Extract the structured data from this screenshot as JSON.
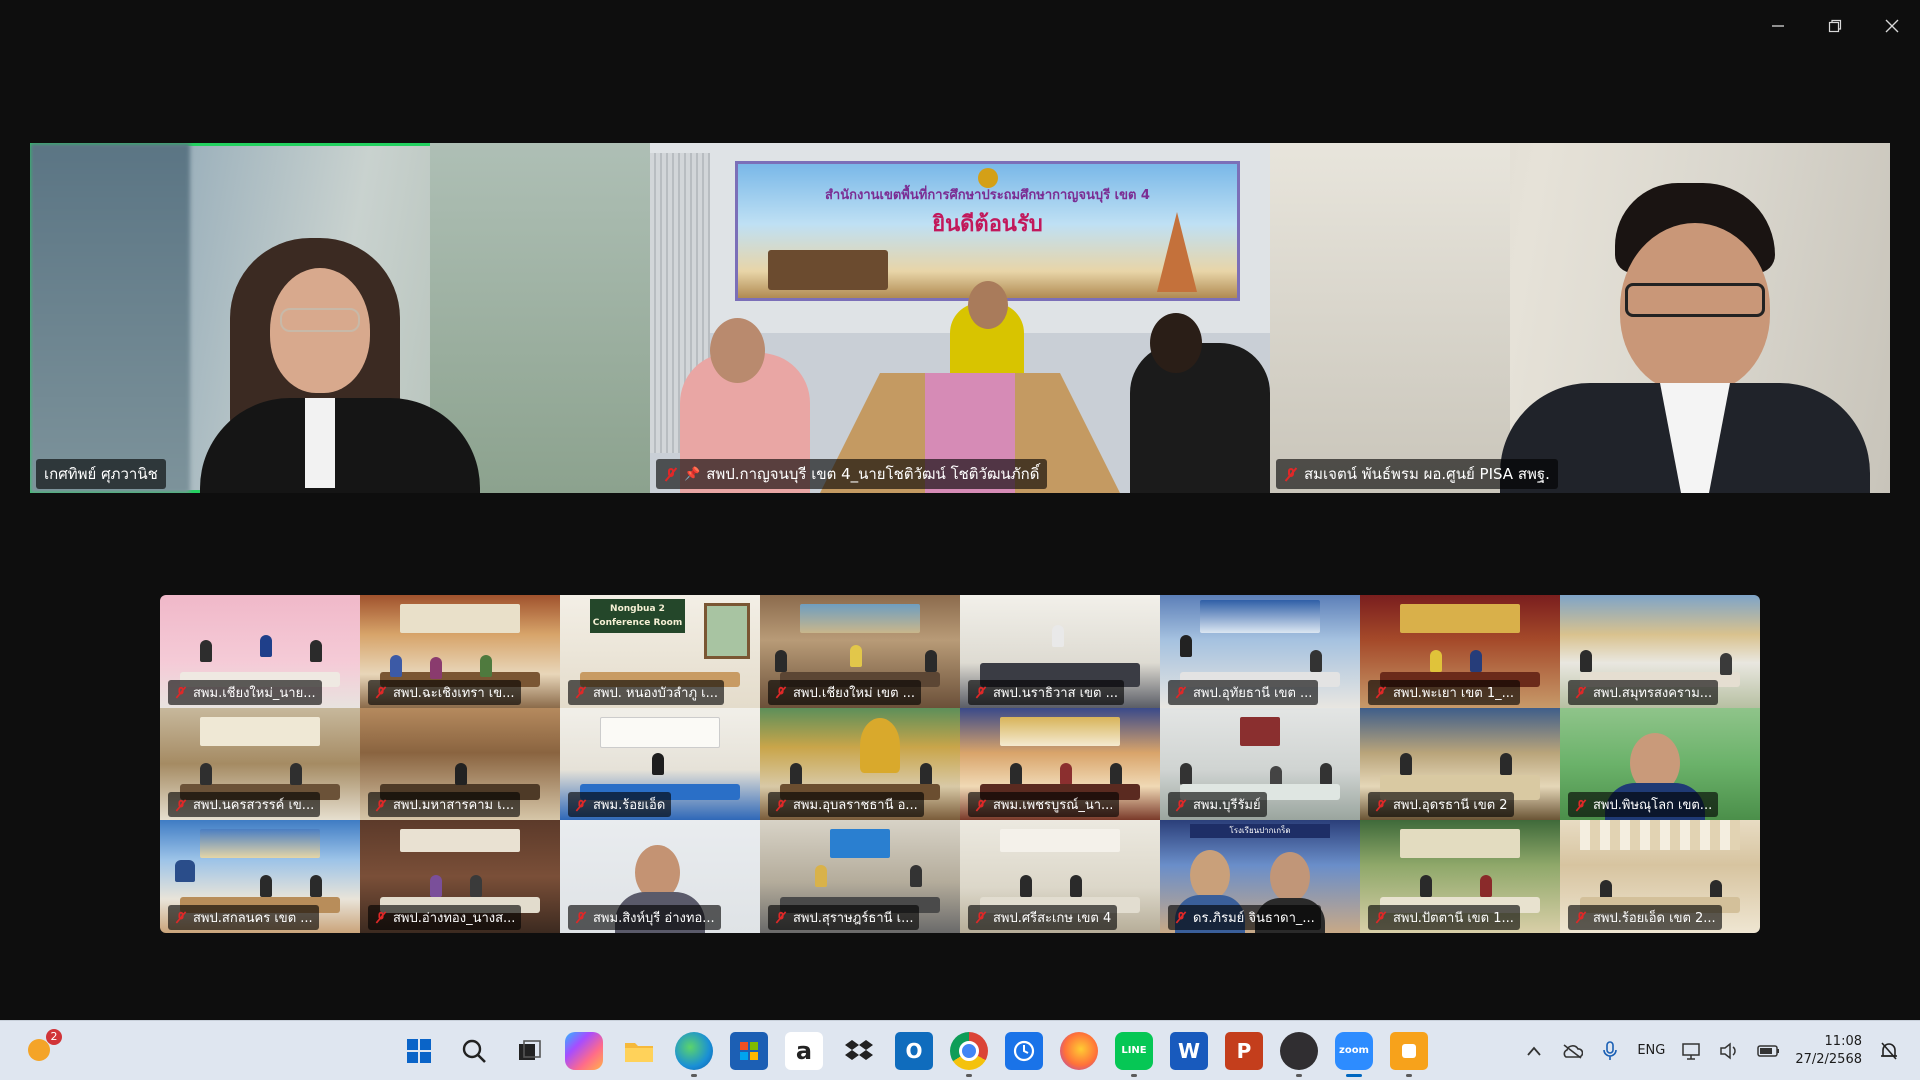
{
  "window": {
    "minimize_icon": "minimize-icon",
    "restore_icon": "restore-icon",
    "close_icon": "close-icon"
  },
  "speakers": [
    {
      "name": "เกศทิพย์ ศุภวานิช",
      "muted": false,
      "pinned": false,
      "active": true
    },
    {
      "name": "สพป.กาญจนบุรี เขต 4_นายโชติวัฒน์ โชติวัฒนภักดิ์",
      "muted": true,
      "pinned": true,
      "active": false
    },
    {
      "name": "สมเจตน์ พันธ์พรม ผอ.ศูนย์ PISA สพฐ.",
      "muted": true,
      "pinned": false,
      "active": false
    }
  ],
  "speaker_scene": {
    "banner_line1": "สำนักงานเขตพื้นที่การศึกษาประถมศึกษากาญจนบุรี เขต 4",
    "banner_line2": "ยินดีต้อนรับ"
  },
  "gallery": [
    {
      "label": "สพม.เชียงใหม่_นาย...",
      "muted": true
    },
    {
      "label": "สพป.ฉะเชิงเทรา เข...",
      "muted": true
    },
    {
      "label": "สพป. หนองบัวลำภู เ...",
      "muted": true,
      "scene_text": "Nongbua 2 Conference Room"
    },
    {
      "label": "สพป.เชียงใหม่ เขต ...",
      "muted": true
    },
    {
      "label": "สพป.นราธิวาส เขต ...",
      "muted": true
    },
    {
      "label": "สพป.อุทัยธานี เขต ...",
      "muted": true
    },
    {
      "label": "สพป.พะเยา เขต 1_...",
      "muted": true
    },
    {
      "label": "สพป.สมุทรสงคราม...",
      "muted": true
    },
    {
      "label": "สพป.นครสวรรค์ เข...",
      "muted": true
    },
    {
      "label": "สพป.มหาสารคาม เ...",
      "muted": true
    },
    {
      "label": "สพม.ร้อยเอ็ด",
      "muted": true
    },
    {
      "label": "สพม.อุบลราชธานี อ...",
      "muted": true
    },
    {
      "label": "สพม.เพชรบูรณ์_นา...",
      "muted": true
    },
    {
      "label": "สพม.บุรีรัมย์",
      "muted": true
    },
    {
      "label": "สพป.อุดรธานี เขต 2",
      "muted": true
    },
    {
      "label": "สพป.พิษณุโลก เขต...",
      "muted": true
    },
    {
      "label": "สพป.สกลนคร เขต ...",
      "muted": true
    },
    {
      "label": "สพป.อ่างทอง_นางส...",
      "muted": true
    },
    {
      "label": "สพม.สิงห์บุรี อ่างทอ...",
      "muted": true
    },
    {
      "label": "สพป.สุราษฎร์ธานี เ...",
      "muted": true
    },
    {
      "label": "สพป.ศรีสะเกษ เขต 4",
      "muted": true
    },
    {
      "label": "ดร.ภิรมย์ จินธาดา_...",
      "muted": true,
      "scene_text": "โรงเรียนปากเกร็ด"
    },
    {
      "label": "สพป.ปัตตานี เขต 1...",
      "muted": true
    },
    {
      "label": "สพป.ร้อยเอ็ด เขต 2...",
      "muted": true
    }
  ],
  "taskbar": {
    "weather_badge": "2",
    "apps": [
      "windows-start",
      "search",
      "task-view",
      "copilot",
      "file-explorer",
      "edge",
      "microsoft-store",
      "amazon",
      "dropbox",
      "outlook",
      "chrome",
      "clock-app",
      "firefox",
      "line",
      "word",
      "powerpoint",
      "obs",
      "zoom",
      "app-orange"
    ],
    "language": "ENG",
    "time": "11:08",
    "date": "27/2/2568"
  }
}
